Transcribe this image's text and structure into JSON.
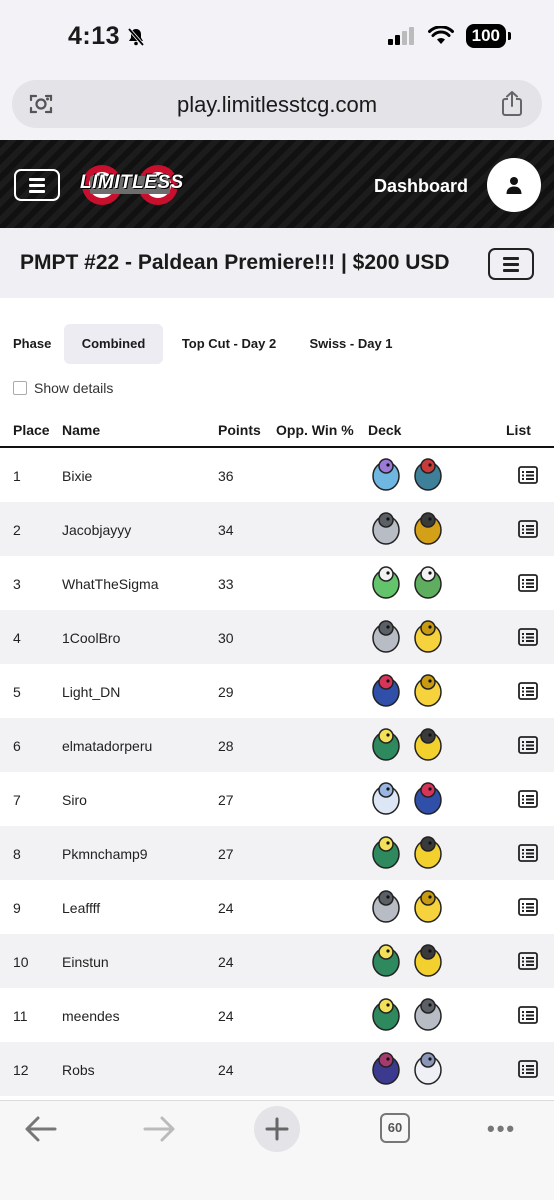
{
  "status_bar": {
    "time": "4:13",
    "battery": "100"
  },
  "browser": {
    "url": "play.limitlesstcg.com",
    "tab_count": "60"
  },
  "header": {
    "logo_text": "LIMITLESS",
    "dashboard_label": "Dashboard"
  },
  "tournament": {
    "title": "PMPT #22 - Paldean Premiere!!! | $200 USD"
  },
  "phase": {
    "label": "Phase",
    "tabs": [
      "Combined",
      "Top Cut - Day 2",
      "Swiss - Day 1"
    ],
    "selected": "Combined"
  },
  "show_details_label": "Show details",
  "table": {
    "columns": {
      "place": "Place",
      "name": "Name",
      "points": "Points",
      "opp": "Opp. Win %",
      "deck": "Deck",
      "list": "List"
    },
    "rows": [
      {
        "place": "1",
        "name": "Bixie",
        "points": "36",
        "opp": "",
        "deck": [
          "suicune-icon",
          "feraligatr-icon"
        ]
      },
      {
        "place": "2",
        "name": "Jacobjayyy",
        "points": "34",
        "opp": "",
        "deck": [
          "magnezone-icon",
          "heliolisk-icon"
        ]
      },
      {
        "place": "3",
        "name": "WhatTheSigma",
        "points": "33",
        "opp": "",
        "deck": [
          "gardevoir-icon",
          "kirlia-icon"
        ]
      },
      {
        "place": "4",
        "name": "1CoolBro",
        "points": "30",
        "opp": "",
        "deck": [
          "magnezone-icon",
          "pikachu-icon"
        ]
      },
      {
        "place": "5",
        "name": "Light_DN",
        "points": "29",
        "opp": "",
        "deck": [
          "greninja-icon",
          "pikachu-icon"
        ]
      },
      {
        "place": "6",
        "name": "elmatadorperu",
        "points": "28",
        "opp": "",
        "deck": [
          "bellibolt-icon",
          "zeraora-icon"
        ]
      },
      {
        "place": "7",
        "name": "Siro",
        "points": "27",
        "opp": "",
        "deck": [
          "florges-icon",
          "greninja-icon"
        ]
      },
      {
        "place": "8",
        "name": "Pkmnchamp9",
        "points": "27",
        "opp": "",
        "deck": [
          "bellibolt-icon",
          "zeraora-icon"
        ]
      },
      {
        "place": "9",
        "name": "Leaffff",
        "points": "24",
        "opp": "",
        "deck": [
          "magnezone-icon",
          "pikachu-icon"
        ]
      },
      {
        "place": "10",
        "name": "Einstun",
        "points": "24",
        "opp": "",
        "deck": [
          "bellibolt-icon",
          "zeraora-icon"
        ]
      },
      {
        "place": "11",
        "name": "meendes",
        "points": "24",
        "opp": "",
        "deck": [
          "bellibolt-icon",
          "magnezone-icon"
        ]
      },
      {
        "place": "12",
        "name": "Robs",
        "points": "24",
        "opp": "",
        "deck": [
          "hydreigon-icon",
          "lugia-icon"
        ]
      }
    ]
  },
  "sprite_colors": {
    "suicune-icon": [
      "#6fb6e0",
      "#9b7ad8"
    ],
    "feraligatr-icon": [
      "#3e7f9a",
      "#c93a3a"
    ],
    "magnezone-icon": [
      "#b8bcc4",
      "#5b5f66"
    ],
    "heliolisk-icon": [
      "#d4a017",
      "#3a3a3a"
    ],
    "gardevoir-icon": [
      "#63c46b",
      "#f2f2f2"
    ],
    "kirlia-icon": [
      "#5fae5f",
      "#f2f2f2"
    ],
    "pikachu-icon": [
      "#f6d33c",
      "#c89a12"
    ],
    "greninja-icon": [
      "#2f4fa8",
      "#d8345a"
    ],
    "bellibolt-icon": [
      "#2e8a5e",
      "#f2e05a"
    ],
    "zeraora-icon": [
      "#f2d12e",
      "#3a3a3a"
    ],
    "florges-icon": [
      "#dde6f4",
      "#9ab6e0"
    ],
    "hydreigon-icon": [
      "#3b3a8f",
      "#a43a6e"
    ],
    "lugia-icon": [
      "#eef0f6",
      "#8a96b8"
    ]
  }
}
